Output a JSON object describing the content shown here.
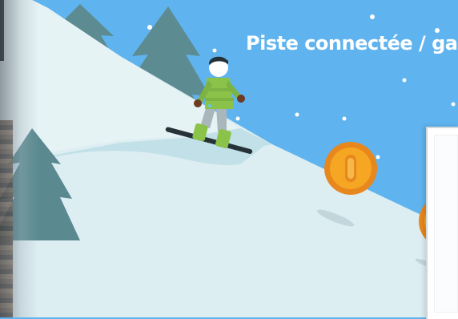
{
  "game": {
    "title": "Piste connectée / gar"
  },
  "colors": {
    "sky": "#5fb3ee",
    "snow": "#ddeef2",
    "snow_shadow": "#c4e1e8",
    "tree": "#5a8a90",
    "coin": "#f5a623",
    "coin_rim": "#e8871d",
    "jacket": "#8bc34a",
    "board": "#263238"
  },
  "icons": [
    "snowboarder-icon",
    "coin-icon",
    "pine-tree-icon",
    "snowflake-icon"
  ]
}
